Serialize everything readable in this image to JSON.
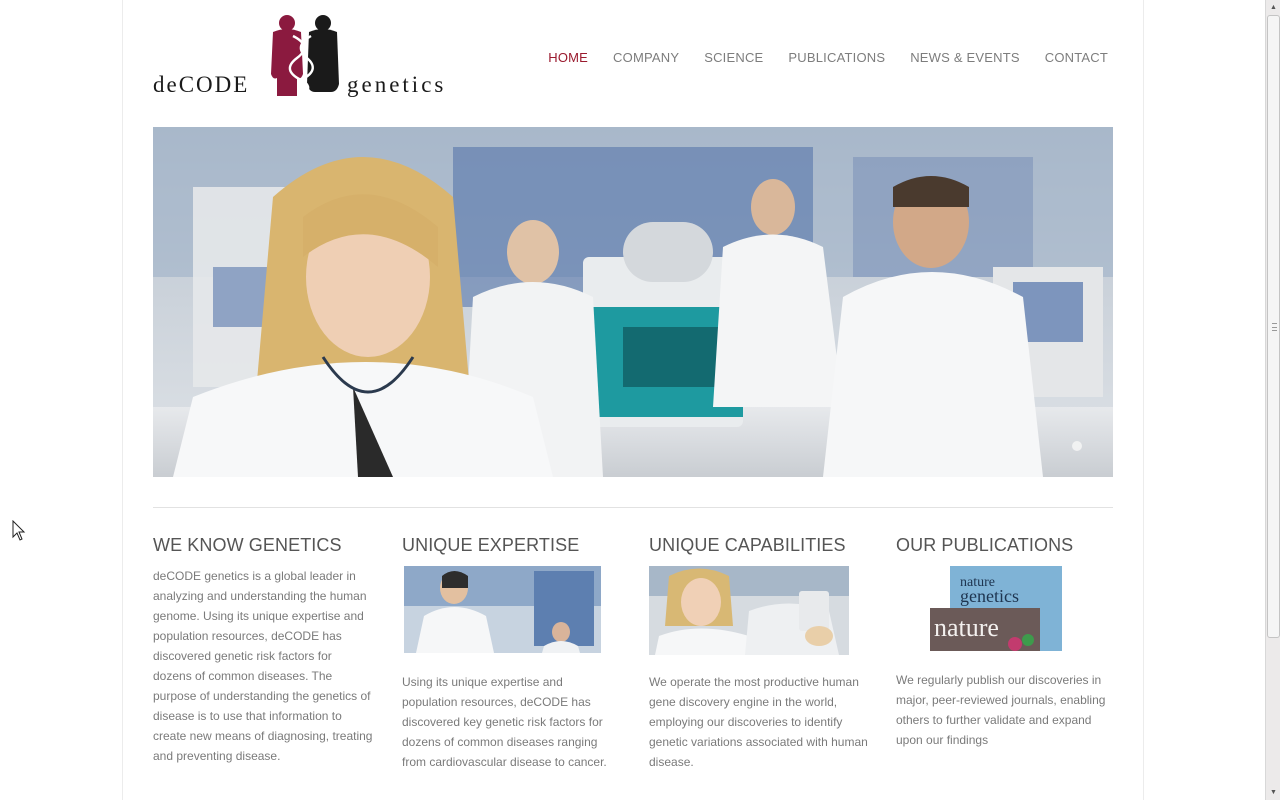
{
  "logo": {
    "text_left": "deCODE",
    "text_right": "genetics",
    "colors": {
      "maroon": "#8b1a3f",
      "dark": "#1a1a1a"
    }
  },
  "nav": {
    "items": [
      {
        "label": "HOME",
        "active": true
      },
      {
        "label": "COMPANY",
        "active": false
      },
      {
        "label": "SCIENCE",
        "active": false
      },
      {
        "label": "PUBLICATIONS",
        "active": false
      },
      {
        "label": "NEWS & EVENTS",
        "active": false
      },
      {
        "label": "CONTACT",
        "active": false
      }
    ],
    "active_color": "#9a1a2e",
    "color": "#7d7d7d"
  },
  "hero": {
    "slides_count": 1,
    "current_slide": 1
  },
  "columns": [
    {
      "title": "WE KNOW GENETICS",
      "text": "deCODE genetics is a global leader in analyzing and understanding the human genome. Using its unique expertise and population resources, deCODE has discovered genetic risk factors for dozens of common diseases. The purpose of understanding the genetics of disease is to use that information to create new means of diagnosing, treating and preventing disease."
    },
    {
      "title": "UNIQUE EXPERTISE",
      "text": "Using its unique expertise and population resources, deCODE has discovered key genetic risk factors for dozens of common diseases ranging from cardiovascular disease to cancer."
    },
    {
      "title": "UNIQUE CAPABILITIES",
      "text": "We operate the most productive human gene discovery engine in the world, employing our discoveries to identify genetic variations associated with human disease."
    },
    {
      "title": "OUR PUBLICATIONS",
      "text": "We regularly publish our discoveries in major, peer-reviewed journals, enabling others to further validate and expand upon our findings",
      "thumb_lines": [
        "nature",
        "genetics",
        "nature"
      ]
    }
  ],
  "scrollbar": {
    "up_icon": "arrow-up-icon",
    "down_icon": "arrow-down-icon"
  }
}
